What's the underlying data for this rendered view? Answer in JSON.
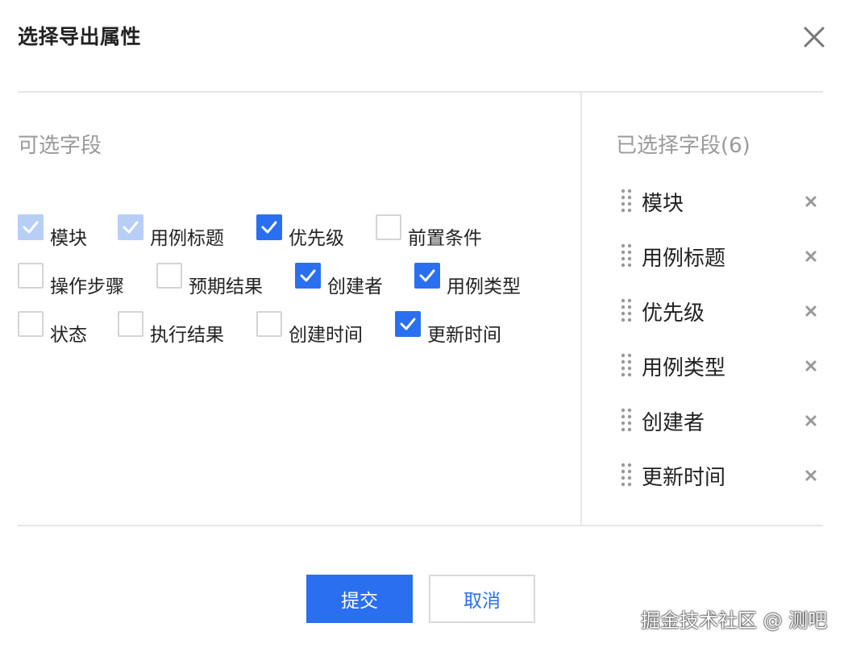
{
  "dialog": {
    "title": "选择导出属性"
  },
  "available": {
    "title": "可选字段",
    "fields": [
      {
        "label": "模块",
        "state": "checked-disabled"
      },
      {
        "label": "用例标题",
        "state": "checked-disabled"
      },
      {
        "label": "优先级",
        "state": "checked"
      },
      {
        "label": "前置条件",
        "state": "unchecked"
      },
      {
        "label": "操作步骤",
        "state": "unchecked"
      },
      {
        "label": "预期结果",
        "state": "unchecked"
      },
      {
        "label": "创建者",
        "state": "checked"
      },
      {
        "label": "用例类型",
        "state": "checked"
      },
      {
        "label": "状态",
        "state": "unchecked"
      },
      {
        "label": "执行结果",
        "state": "unchecked"
      },
      {
        "label": "创建时间",
        "state": "unchecked"
      },
      {
        "label": "更新时间",
        "state": "checked"
      }
    ]
  },
  "selected": {
    "title": "已选择字段(6)",
    "items": [
      {
        "label": "模块"
      },
      {
        "label": "用例标题"
      },
      {
        "label": "优先级"
      },
      {
        "label": "用例类型"
      },
      {
        "label": "创建者"
      },
      {
        "label": "更新时间"
      }
    ]
  },
  "buttons": {
    "submit": "提交",
    "cancel": "取消"
  },
  "watermark": "掘金技术社区 @ 测吧",
  "colors": {
    "primary": "#2a6ff0",
    "disabled_check": "#b7cff7",
    "muted_text": "#9a9a9a",
    "divider": "#e6e6e6"
  },
  "icons": {
    "close": "close-icon",
    "drag": "drag-handle-icon",
    "remove": "remove-icon",
    "check": "check-icon"
  }
}
